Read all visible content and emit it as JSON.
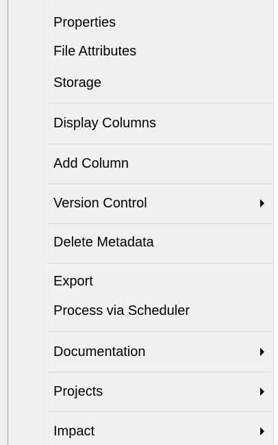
{
  "menu": {
    "items": [
      {
        "label": "Properties"
      },
      {
        "label": "File Attributes"
      },
      {
        "label": "Storage"
      },
      {
        "label": "Display Columns"
      },
      {
        "label": "Add Column"
      },
      {
        "label": "Version Control",
        "has_submenu": true
      },
      {
        "label": "Delete Metadata"
      },
      {
        "label": "Export"
      },
      {
        "label": "Process via Scheduler"
      },
      {
        "label": "Documentation",
        "has_submenu": true
      },
      {
        "label": "Projects",
        "has_submenu": true
      },
      {
        "label": "Impact",
        "has_submenu": true
      }
    ]
  }
}
